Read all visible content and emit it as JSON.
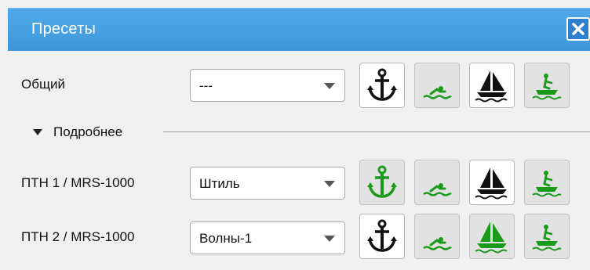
{
  "window": {
    "title": "Пресеты",
    "close_label": "X"
  },
  "rows": [
    {
      "label": "Общий",
      "combo_value": "---",
      "buttons": [
        {
          "icon": "anchor-icon",
          "color": "#111111",
          "state": "normal"
        },
        {
          "icon": "swimmer-icon",
          "color": "#1a9a1a",
          "state": "dim"
        },
        {
          "icon": "sailboat-icon",
          "color": "#111111",
          "state": "normal"
        },
        {
          "icon": "jetski-icon",
          "color": "#1a9a1a",
          "state": "dim"
        }
      ]
    },
    {
      "label": "ПТН 1 / MRS-1000",
      "combo_value": "Штиль",
      "buttons": [
        {
          "icon": "anchor-icon",
          "color": "#1a9a1a",
          "state": "dim"
        },
        {
          "icon": "swimmer-icon",
          "color": "#1a9a1a",
          "state": "dim"
        },
        {
          "icon": "sailboat-icon",
          "color": "#111111",
          "state": "normal"
        },
        {
          "icon": "jetski-icon",
          "color": "#1a9a1a",
          "state": "dim"
        }
      ]
    },
    {
      "label": "ПТН 2 / MRS-1000",
      "combo_value": "Волны-1",
      "buttons": [
        {
          "icon": "anchor-icon",
          "color": "#111111",
          "state": "normal"
        },
        {
          "icon": "swimmer-icon",
          "color": "#1a9a1a",
          "state": "dim"
        },
        {
          "icon": "sailboat-icon",
          "color": "#1a9a1a",
          "state": "dim"
        },
        {
          "icon": "jetski-icon",
          "color": "#1a9a1a",
          "state": "dim"
        }
      ]
    }
  ],
  "details": {
    "label": "Подробнее"
  },
  "colors": {
    "titlebar": "#4aa3e5",
    "accent_green": "#1a9a1a",
    "icon_black": "#111111"
  }
}
